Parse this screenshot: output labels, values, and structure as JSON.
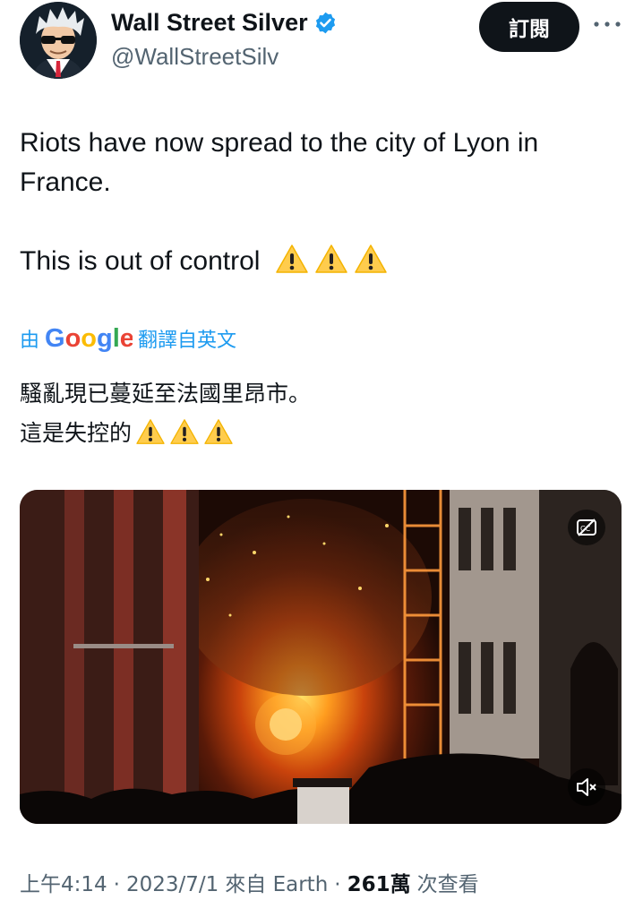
{
  "author": {
    "display_name": "Wall Street Silver",
    "handle": "@WallStreetSilv",
    "verified": true,
    "verified_color": "#1d9bf0"
  },
  "actions": {
    "subscribe_label": "訂閱",
    "more_icon": "more-horizontal-icon"
  },
  "tweet": {
    "text_lines": [
      "Riots have now spread to the city of Lyon in",
      "France."
    ],
    "text_line_2": "This is out of control",
    "emoji": [
      "warning",
      "warning",
      "warning"
    ]
  },
  "translation": {
    "prefix": "由",
    "provider": "Google",
    "suffix": "翻譯自英文",
    "lines": [
      "騷亂現已蔓延至法國里昂市。",
      "這是失控的"
    ]
  },
  "media": {
    "type": "video",
    "cc_icon": "closed-captions-off-icon",
    "mute_icon": "volume-muted-icon"
  },
  "meta": {
    "time": "上午4:14",
    "sep1": "·",
    "date": "2023/7/1",
    "source": "來自 Earth",
    "sep2": "·",
    "views": "261萬",
    "views_suffix": "次查看"
  },
  "colors": {
    "accent": "#1d9bf0",
    "text": "#0f1419",
    "secondary": "#536471"
  }
}
